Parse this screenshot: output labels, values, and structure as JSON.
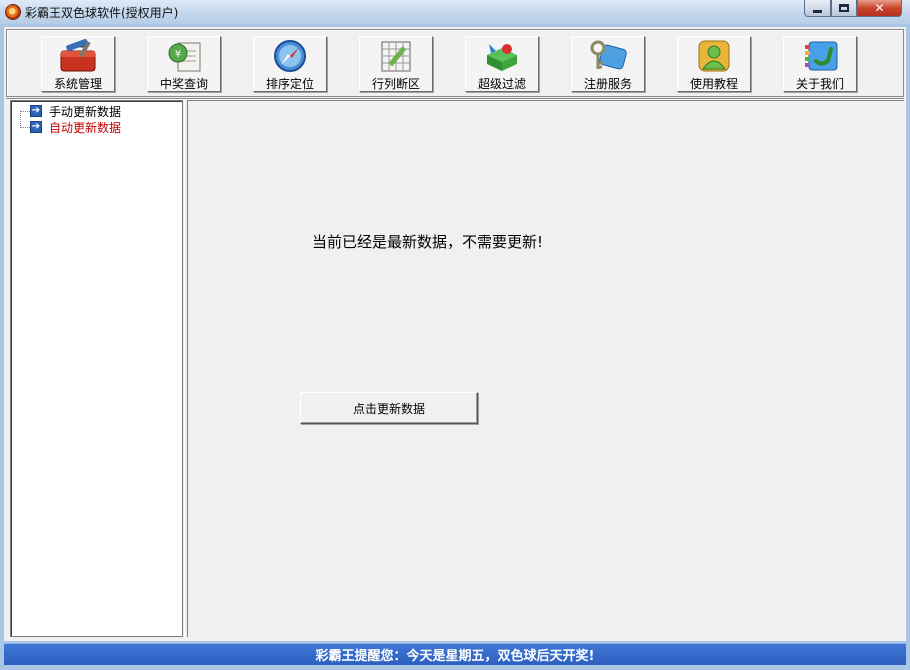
{
  "window": {
    "title": "彩霸王双色球软件(授权用户)"
  },
  "toolbar": {
    "buttons": [
      {
        "label": "系统管理",
        "icon": "toolbox-icon"
      },
      {
        "label": "中奖查询",
        "icon": "lottery-document-icon"
      },
      {
        "label": "排序定位",
        "icon": "compass-icon"
      },
      {
        "label": "行列断区",
        "icon": "grid-pencil-icon"
      },
      {
        "label": "超级过滤",
        "icon": "filter-cube-icon"
      },
      {
        "label": "注册服务",
        "icon": "key-icon"
      },
      {
        "label": "使用教程",
        "icon": "user-tutorial-icon"
      },
      {
        "label": "关于我们",
        "icon": "phone-contact-icon"
      }
    ]
  },
  "tree": {
    "items": [
      {
        "label": "手动更新数据",
        "color": "#000000"
      },
      {
        "label": "自动更新数据",
        "color": "#c00000"
      }
    ]
  },
  "main": {
    "message": "当前已经是最新数据，不需要更新!",
    "update_button_label": "点击更新数据"
  },
  "status": {
    "text": "彩霸王提醒您：今天是星期五，双色球后天开奖!"
  }
}
